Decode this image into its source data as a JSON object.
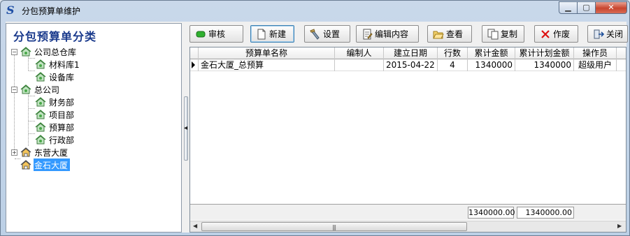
{
  "window": {
    "title": "分包预算单维护"
  },
  "left_panel": {
    "header": "分包预算单分类",
    "tree": [
      {
        "label": "公司总仓库",
        "level": 0,
        "expander": "−"
      },
      {
        "label": "材料库1",
        "level": 1
      },
      {
        "label": "设备库",
        "level": 1
      },
      {
        "label": "总公司",
        "level": 0,
        "expander": "−"
      },
      {
        "label": "财务部",
        "level": 1
      },
      {
        "label": "项目部",
        "level": 1
      },
      {
        "label": "预算部",
        "level": 1
      },
      {
        "label": "行政部",
        "level": 1
      },
      {
        "label": "东营大厦",
        "level": 0,
        "expander": "+"
      },
      {
        "label": "金石大厦",
        "level": 0,
        "selected": true
      }
    ]
  },
  "toolbar": {
    "audit": "审核",
    "new": "新建",
    "settings": "设置",
    "edit_content": "编辑内容",
    "view": "查看",
    "copy": "复制",
    "void": "作废",
    "close": "关闭"
  },
  "grid": {
    "columns": [
      "预算单名称",
      "编制人",
      "建立日期",
      "行数",
      "累计金额",
      "累计计划金额",
      "操作员"
    ],
    "rows": [
      [
        "金石大厦_总预算",
        "",
        "2015-04-22",
        "4",
        "1340000",
        "1340000",
        "超级用户"
      ]
    ],
    "footer_totals": [
      "1340000.00",
      "1340000.00"
    ]
  },
  "colors": {
    "selection": "#3399ff",
    "header_text": "#1a3a8c",
    "close_button": "#c8452e"
  }
}
